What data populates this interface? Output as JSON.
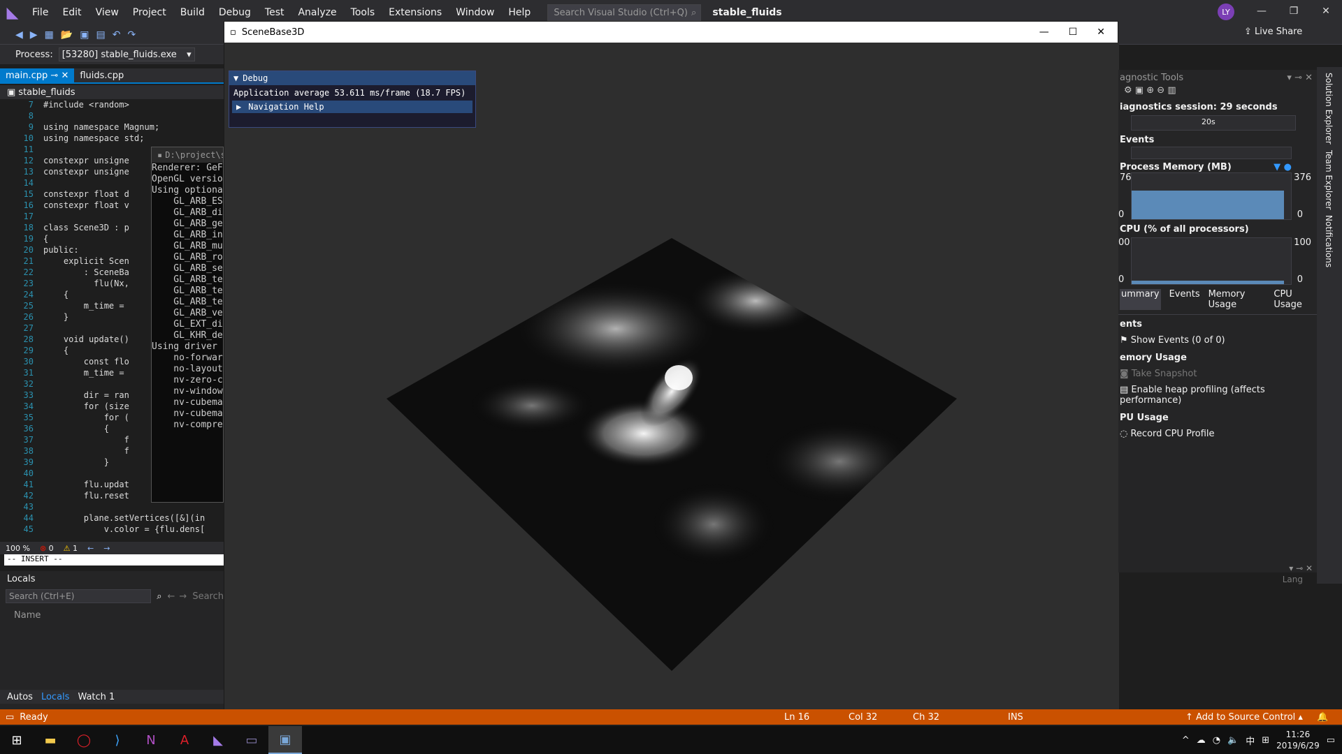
{
  "menubar": {
    "items": [
      "File",
      "Edit",
      "View",
      "Project",
      "Build",
      "Debug",
      "Test",
      "Analyze",
      "Tools",
      "Extensions",
      "Window",
      "Help"
    ],
    "search_placeholder": "Search Visual Studio (Ctrl+Q)",
    "solution_name": "stable_fluids",
    "avatar_initials": "LY",
    "live_share": "Live Share"
  },
  "processbar": {
    "label": "Process:",
    "value": "[53280] stable_fluids.exe"
  },
  "tabs": [
    {
      "label": "main.cpp",
      "active": true
    },
    {
      "label": "fluids.cpp",
      "active": false
    }
  ],
  "breadcrumb": "stable_fluids",
  "code_lines": [
    {
      "n": "7",
      "text": "#include <random>"
    },
    {
      "n": "8",
      "text": ""
    },
    {
      "n": "9",
      "text": "using namespace Magnum;"
    },
    {
      "n": "10",
      "text": "using namespace std;"
    },
    {
      "n": "11",
      "text": ""
    },
    {
      "n": "12",
      "text": "constexpr unsigne"
    },
    {
      "n": "13",
      "text": "constexpr unsigne"
    },
    {
      "n": "14",
      "text": ""
    },
    {
      "n": "15",
      "text": "constexpr float d"
    },
    {
      "n": "16",
      "text": "constexpr float v"
    },
    {
      "n": "17",
      "text": ""
    },
    {
      "n": "18",
      "text": "class Scene3D : p"
    },
    {
      "n": "19",
      "text": "{"
    },
    {
      "n": "20",
      "text": "public:"
    },
    {
      "n": "21",
      "text": "    explicit Scen"
    },
    {
      "n": "22",
      "text": "        : SceneBa"
    },
    {
      "n": "23",
      "text": "          flu(Nx,"
    },
    {
      "n": "24",
      "text": "    {"
    },
    {
      "n": "25",
      "text": "        m_time ="
    },
    {
      "n": "26",
      "text": "    }"
    },
    {
      "n": "27",
      "text": ""
    },
    {
      "n": "28",
      "text": "    void update()"
    },
    {
      "n": "29",
      "text": "    {"
    },
    {
      "n": "30",
      "text": "        const flo"
    },
    {
      "n": "31",
      "text": "        m_time ="
    },
    {
      "n": "32",
      "text": ""
    },
    {
      "n": "33",
      "text": "        dir = ran"
    },
    {
      "n": "34",
      "text": "        for (size"
    },
    {
      "n": "35",
      "text": "            for ("
    },
    {
      "n": "36",
      "text": "            {"
    },
    {
      "n": "37",
      "text": "                f"
    },
    {
      "n": "38",
      "text": "                f"
    },
    {
      "n": "39",
      "text": "            }"
    },
    {
      "n": "40",
      "text": ""
    },
    {
      "n": "41",
      "text": "        flu.updat"
    },
    {
      "n": "42",
      "text": "        flu.reset"
    },
    {
      "n": "43",
      "text": ""
    },
    {
      "n": "44",
      "text": "        plane.setVertices([&](in"
    },
    {
      "n": "45",
      "text": "            v.color = {flu.dens["
    }
  ],
  "console": {
    "title": "D:\\project\\st",
    "lines": [
      "Renderer: GeF",
      "OpenGL versio",
      "Using optiona",
      "    GL_ARB_ES",
      "    GL_ARB_di",
      "    GL_ARB_ge",
      "    GL_ARB_in",
      "    GL_ARB_mu",
      "    GL_ARB_ro",
      "    GL_ARB_se",
      "    GL_ARB_te",
      "    GL_ARB_te",
      "    GL_ARB_te",
      "    GL_ARB_ve",
      "    GL_EXT_di",
      "    GL_KHR_de",
      "Using driver ",
      "    no-forwar",
      "    no-layout",
      "    nv-zero-c",
      "    nv-window",
      "    nv-cubema",
      "    nv-cubema",
      "    nv-compre"
    ]
  },
  "editor_status": {
    "zoom": "100 %",
    "errors": "0",
    "warnings": "1"
  },
  "insert_mode": "-- INSERT --",
  "locals": {
    "title": "Locals",
    "search_placeholder": "Search (Ctrl+E)",
    "search_depth": "Search",
    "column_name": "Name",
    "tabs": [
      "Autos",
      "Locals",
      "Watch 1"
    ]
  },
  "scene": {
    "title": "SceneBase3D",
    "debug_title": "Debug",
    "fps_text": "Application average 53.611 ms/frame (18.7 FPS)",
    "nav_help": "Navigation Help"
  },
  "diag": {
    "title": "agnostic Tools",
    "session": "iagnostics session: 29 seconds",
    "timeline_label": "20s",
    "events_label": "Events",
    "memory_label": "Process Memory (MB)",
    "memory_max_left": "76",
    "memory_max_right": "376",
    "memory_min": "0",
    "cpu_label": "CPU (% of all processors)",
    "cpu_max_left": "00",
    "cpu_max_right": "100",
    "cpu_min": "0",
    "tabs": [
      "ummary",
      "Events",
      "Memory Usage",
      "CPU Usage"
    ],
    "section_events": "ents",
    "show_events": "Show Events (0 of 0)",
    "section_memory": "emory Usage",
    "take_snapshot": "Take Snapshot",
    "heap_profiling": "Enable heap profiling (affects performance)",
    "section_cpu": "PU Usage",
    "record_cpu": "Record CPU Profile",
    "lang_label": "Lang"
  },
  "right_sidebar": [
    "Solution Explorer",
    "Team Explorer",
    "Notifications"
  ],
  "statusbar": {
    "ready": "Ready",
    "ln": "Ln 16",
    "col": "Col 32",
    "ch": "Ch 32",
    "ins": "INS",
    "source_control": "Add to Source Control"
  },
  "taskbar": {
    "time": "11:26",
    "date": "2019/6/29",
    "ime": "中"
  },
  "colors": {
    "accent": "#007acc",
    "statusbar": "#ca5100",
    "debug_panel": "#294a7a"
  }
}
